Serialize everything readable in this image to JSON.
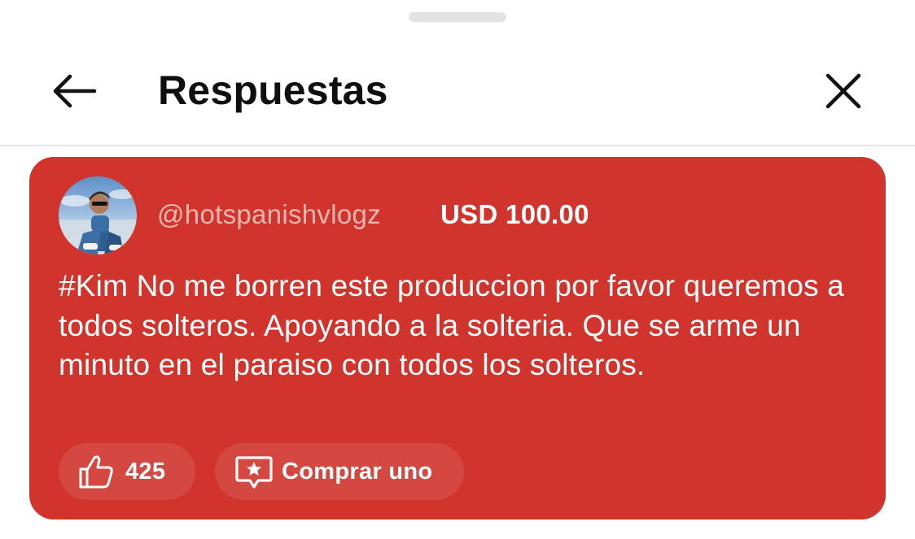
{
  "header": {
    "title": "Respuestas",
    "back_icon": "arrow-left-icon",
    "close_icon": "close-icon"
  },
  "comment": {
    "handle": "@hotspanishvlogz",
    "amount": "USD 100.00",
    "text": "#Kim No me borren este produccion por favor queremos a todos solteros. Apoyando a la solteria. Que se arme un minuto en el paraiso con todos los solteros.",
    "card_color": "#d0342c",
    "likes": "425",
    "buy_label": "Comprar uno"
  }
}
